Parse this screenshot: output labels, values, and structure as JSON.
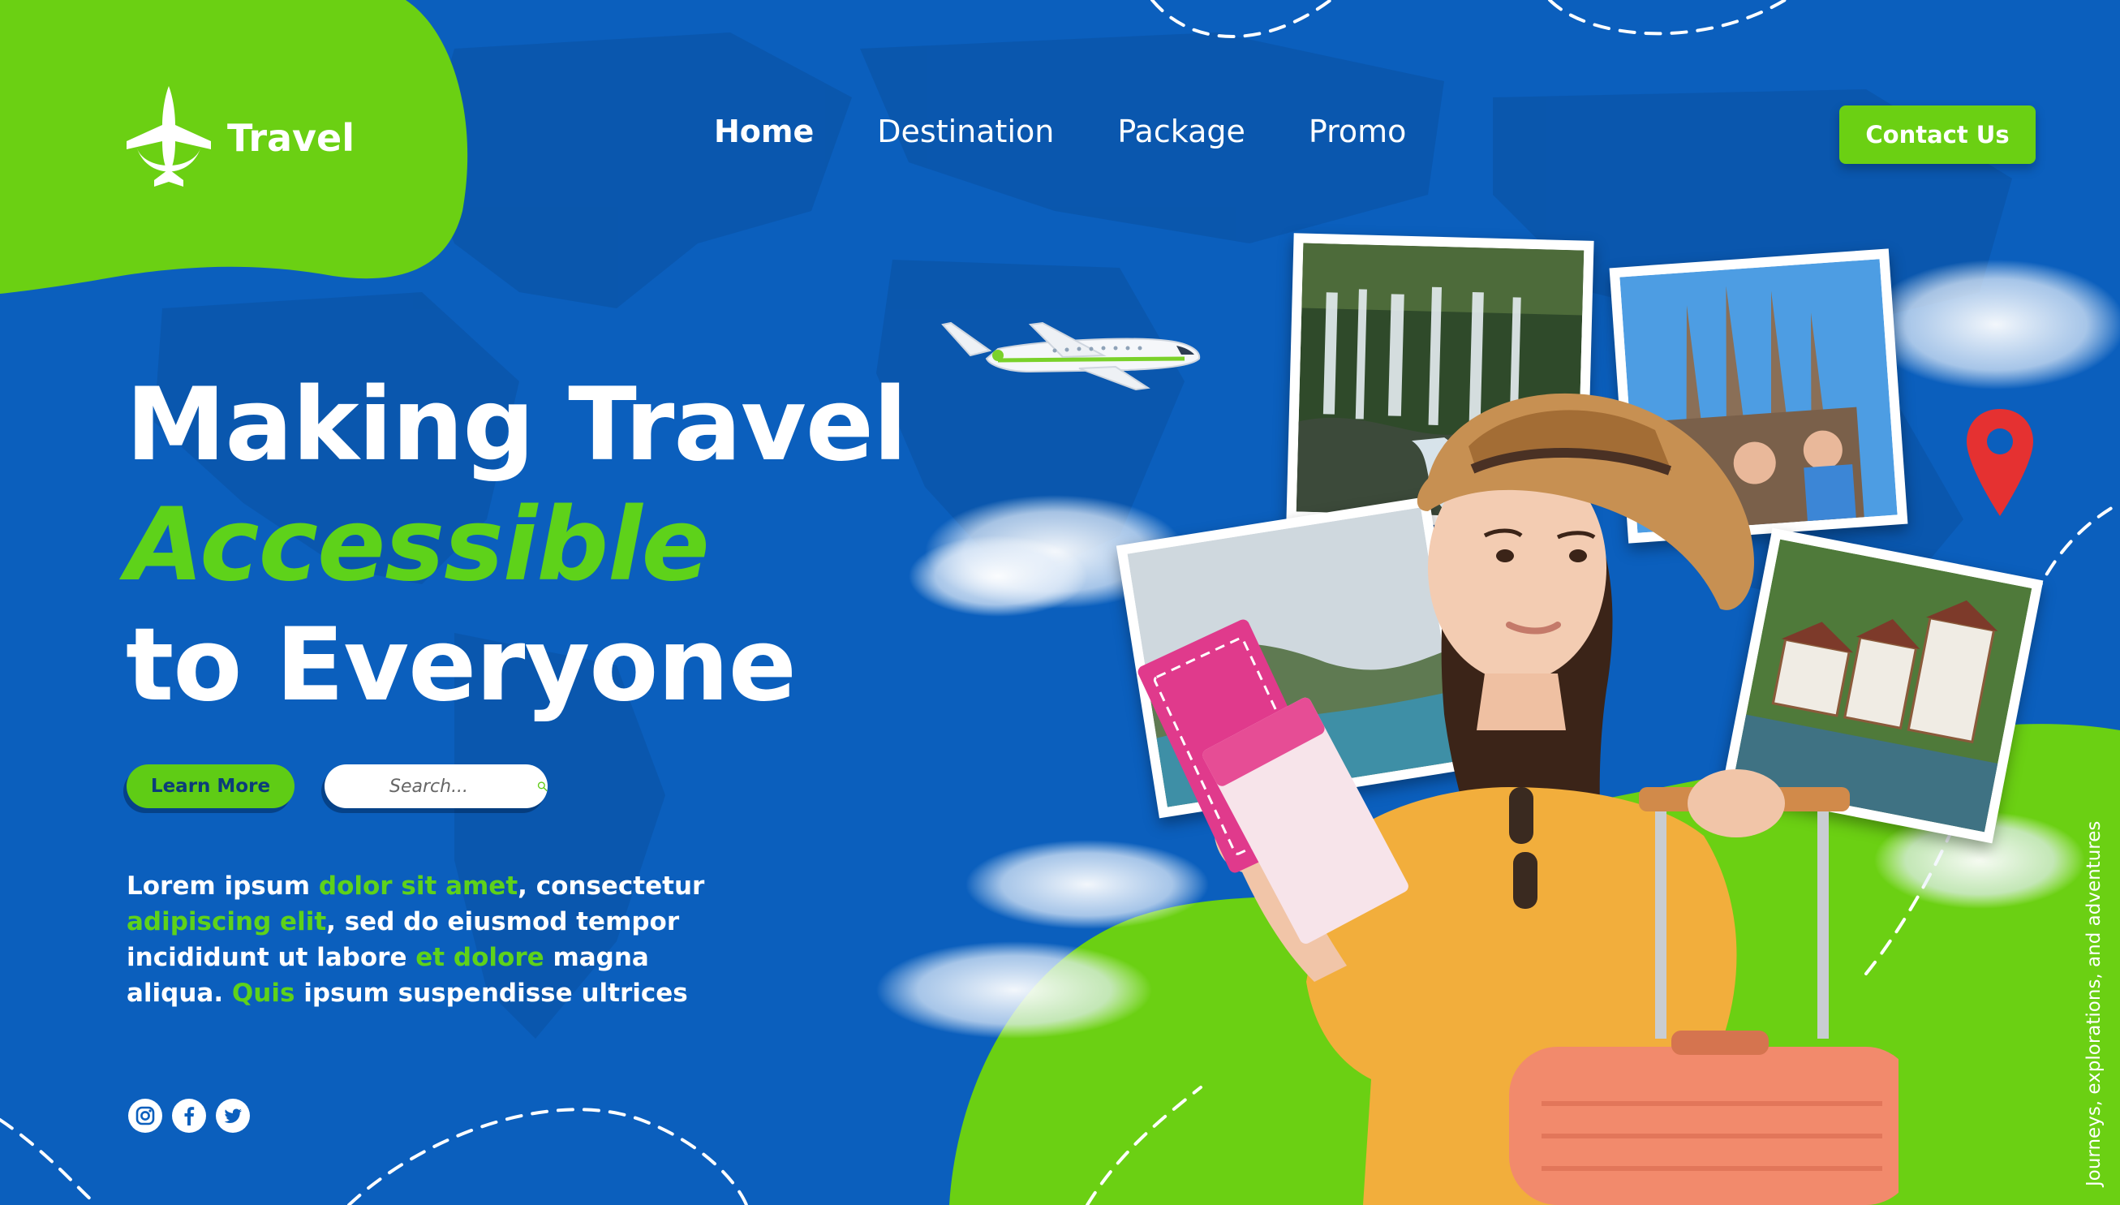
{
  "brand": {
    "name": "Travel"
  },
  "nav": {
    "items": [
      {
        "label": "Home",
        "active": true
      },
      {
        "label": "Destination",
        "active": false
      },
      {
        "label": "Package",
        "active": false
      },
      {
        "label": "Promo",
        "active": false
      }
    ],
    "contact_label": "Contact Us"
  },
  "hero": {
    "line1": "Making Travel",
    "line2": "Accessible",
    "line3": "to Everyone"
  },
  "actions": {
    "learn_more_label": "Learn More",
    "search_placeholder": "Search..."
  },
  "body": {
    "segments": [
      {
        "text": "Lorem ipsum ",
        "highlight": false
      },
      {
        "text": "dolor sit amet",
        "highlight": true
      },
      {
        "text": ", consectetur ",
        "highlight": false
      },
      {
        "text": "adipiscing elit",
        "highlight": true
      },
      {
        "text": ", sed do eiusmod tempor incididunt ut labore ",
        "highlight": false
      },
      {
        "text": "et dolore",
        "highlight": true
      },
      {
        "text": " magna aliqua. ",
        "highlight": false
      },
      {
        "text": "Quis",
        "highlight": true
      },
      {
        "text": " ipsum suspendisse ultrices",
        "highlight": false
      }
    ]
  },
  "socials": [
    "instagram-icon",
    "facebook-icon",
    "twitter-icon"
  ],
  "tagline_vertical": "Journeys, explorations, and adventures",
  "colors": {
    "background_blue": "#0b5fbd",
    "accent_green": "#6bd013",
    "text_white": "#ffffff"
  }
}
